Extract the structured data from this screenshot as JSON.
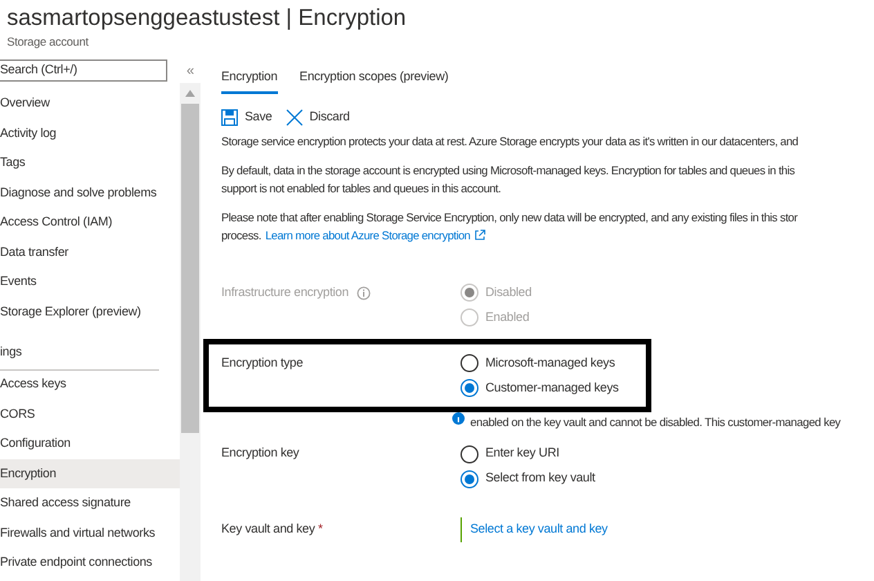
{
  "header": {
    "title": "sasmartopsenggeastustest | Encryption",
    "subtitle": "Storage account"
  },
  "sidebar": {
    "search": {
      "placeholder": "Search (Ctrl+/)"
    },
    "collapse": "«",
    "items": [
      {
        "label": "Overview",
        "kind": "item",
        "selected": false
      },
      {
        "label": "Activity log",
        "kind": "item",
        "selected": false
      },
      {
        "label": "Tags",
        "kind": "item",
        "selected": false
      },
      {
        "label": "Diagnose and solve problems",
        "kind": "item",
        "selected": false
      },
      {
        "label": "Access Control (IAM)",
        "kind": "item",
        "selected": false
      },
      {
        "label": "Data transfer",
        "kind": "item",
        "selected": false
      },
      {
        "label": "Events",
        "kind": "item",
        "selected": false
      },
      {
        "label": "Storage Explorer (preview)",
        "kind": "item",
        "selected": false
      },
      {
        "label": "ings",
        "kind": "heading"
      },
      {
        "label": "Access keys",
        "kind": "item",
        "selected": false
      },
      {
        "label": "CORS",
        "kind": "item",
        "selected": false
      },
      {
        "label": "Configuration",
        "kind": "item",
        "selected": false
      },
      {
        "label": "Encryption",
        "kind": "item",
        "selected": true
      },
      {
        "label": "Shared access signature",
        "kind": "item",
        "selected": false
      },
      {
        "label": "Firewalls and virtual networks",
        "kind": "item",
        "selected": false
      },
      {
        "label": "Private endpoint connections",
        "kind": "item",
        "selected": false
      }
    ]
  },
  "tabs": [
    {
      "label": "Encryption",
      "selected": true
    },
    {
      "label": "Encryption scopes (preview)",
      "selected": false
    }
  ],
  "toolbar": [
    {
      "label": "Save",
      "kind": "save"
    },
    {
      "label": "Discard",
      "kind": "discard"
    }
  ],
  "paragraphs": [
    {
      "lines": [
        "Storage service encryption protects your data at rest. Azure Storage encrypts your data as it's written in our datacenters, and"
      ]
    },
    {
      "lines": [
        "By default, data in the storage account is encrypted using Microsoft-managed keys. Encryption for tables and queues in this",
        "support is not enabled for tables and queues in this account."
      ]
    },
    {
      "lines": [
        "Please note that after enabling Storage Service Encryption, only new data will be encrypted, and any existing files in this stor",
        "process."
      ],
      "link": "Learn more about Azure Storage encryption"
    }
  ],
  "fields": [
    {
      "kind": "radio",
      "label": "Infrastructure encryption",
      "info": true,
      "disabled": true,
      "options": [
        {
          "label": "Disabled",
          "selected": true
        },
        {
          "label": "Enabled",
          "selected": false
        }
      ]
    },
    {
      "kind": "radio",
      "label": "Encryption type",
      "highlighted": true,
      "options": [
        {
          "label": "Microsoft-managed keys",
          "selected": false
        },
        {
          "label": "Customer-managed keys",
          "selected": true
        }
      ],
      "note": "enabled on the key vault and cannot be disabled. This customer-managed key"
    },
    {
      "kind": "radio",
      "label": "Encryption key",
      "options": [
        {
          "label": "Enter key URI",
          "selected": false
        },
        {
          "label": "Select from key vault",
          "selected": true
        }
      ]
    },
    {
      "kind": "link",
      "label": "Key vault and key",
      "required": "*",
      "link": "Select a key vault and key"
    }
  ]
}
